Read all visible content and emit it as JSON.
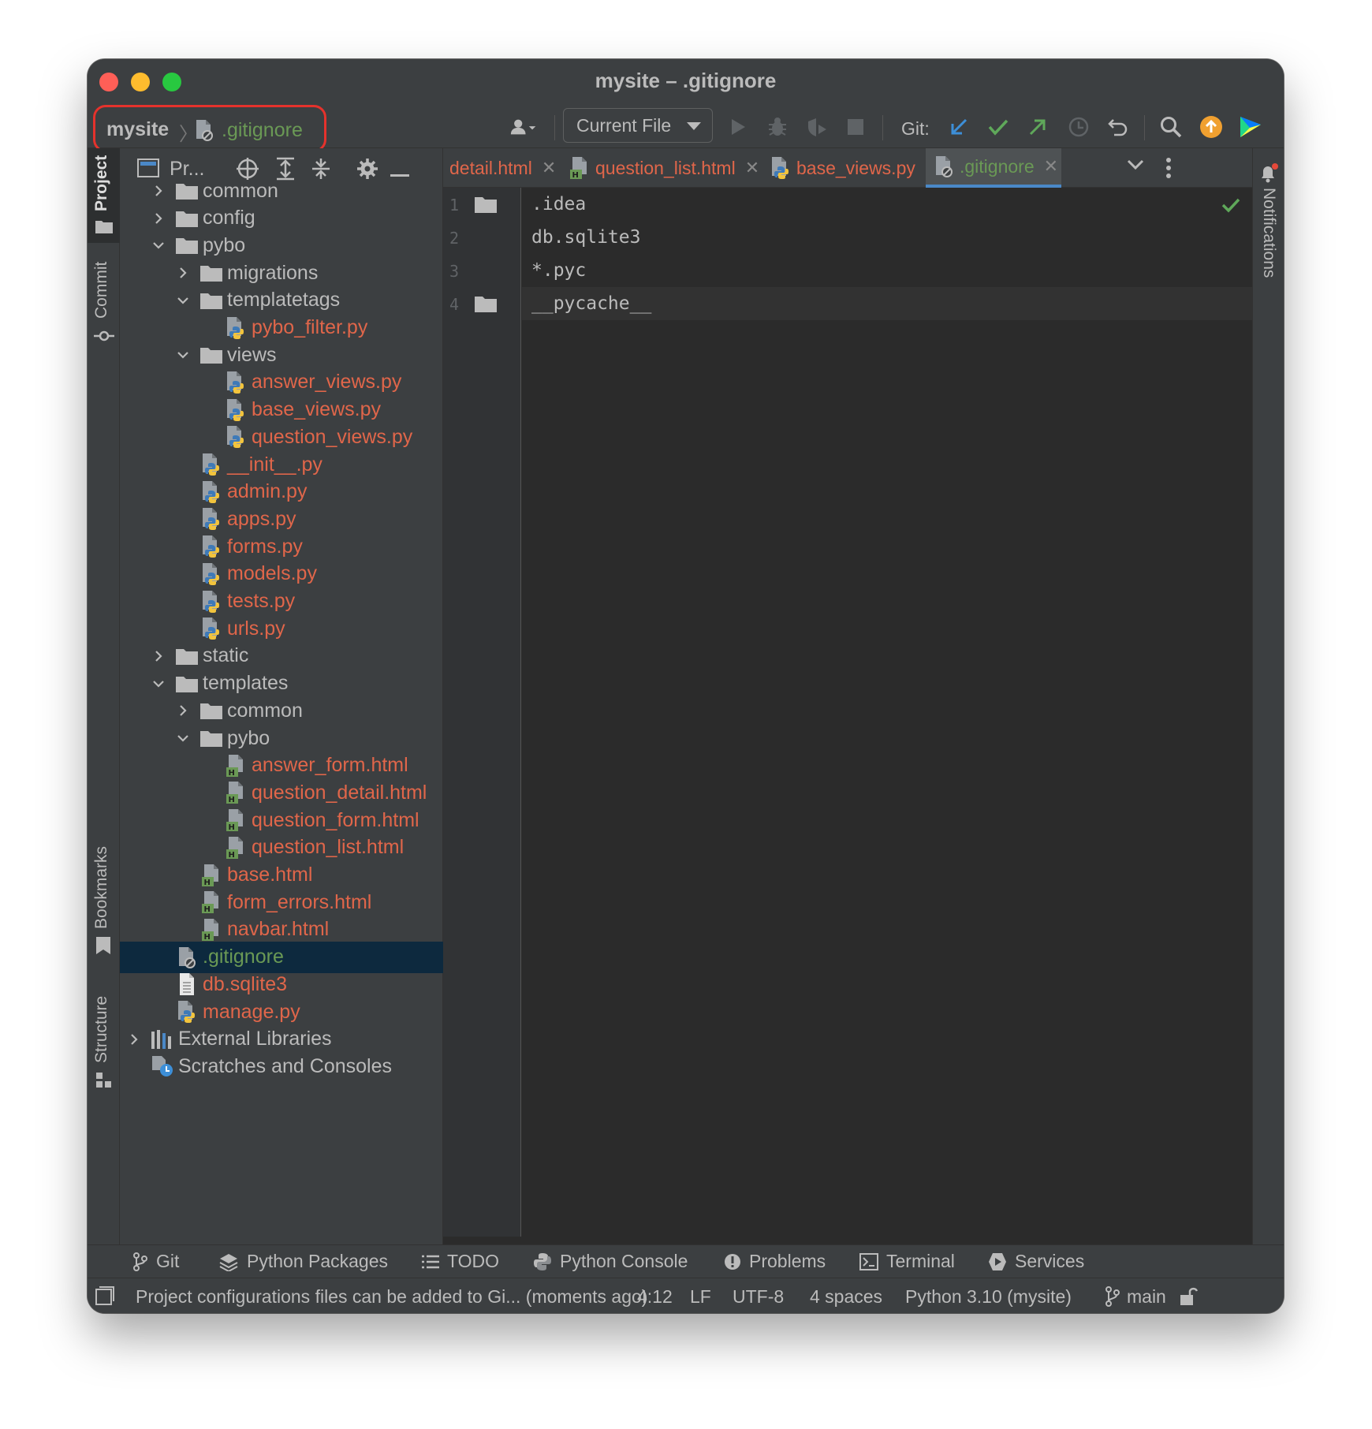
{
  "window": {
    "title": "mysite – .gitignore"
  },
  "breadcrumb": {
    "project": "mysite",
    "file": ".gitignore"
  },
  "toolbar": {
    "run_config": "Current File",
    "git_label": "Git:"
  },
  "left_stripe": {
    "project": "Project",
    "commit": "Commit",
    "bookmarks": "Bookmarks",
    "structure": "Structure"
  },
  "project_panel": {
    "title": "Pr...",
    "tree": [
      {
        "label": "common",
        "kind": "folder",
        "depth": 1,
        "expanded": false
      },
      {
        "label": "config",
        "kind": "folder",
        "depth": 1,
        "expanded": false
      },
      {
        "label": "pybo",
        "kind": "folder",
        "depth": 1,
        "expanded": true
      },
      {
        "label": "migrations",
        "kind": "folder",
        "depth": 2,
        "expanded": false
      },
      {
        "label": "templatetags",
        "kind": "folder",
        "depth": 2,
        "expanded": true
      },
      {
        "label": "pybo_filter.py",
        "kind": "py",
        "depth": 3
      },
      {
        "label": "views",
        "kind": "folder",
        "depth": 2,
        "expanded": true
      },
      {
        "label": "answer_views.py",
        "kind": "py",
        "depth": 3
      },
      {
        "label": "base_views.py",
        "kind": "py",
        "depth": 3
      },
      {
        "label": "question_views.py",
        "kind": "py",
        "depth": 3
      },
      {
        "label": "__init__.py",
        "kind": "py",
        "depth": 2
      },
      {
        "label": "admin.py",
        "kind": "py",
        "depth": 2
      },
      {
        "label": "apps.py",
        "kind": "py",
        "depth": 2
      },
      {
        "label": "forms.py",
        "kind": "py",
        "depth": 2
      },
      {
        "label": "models.py",
        "kind": "py",
        "depth": 2
      },
      {
        "label": "tests.py",
        "kind": "py",
        "depth": 2
      },
      {
        "label": "urls.py",
        "kind": "py",
        "depth": 2
      },
      {
        "label": "static",
        "kind": "folder",
        "depth": 1,
        "expanded": false
      },
      {
        "label": "templates",
        "kind": "folder",
        "depth": 1,
        "expanded": true
      },
      {
        "label": "common",
        "kind": "folder",
        "depth": 2,
        "expanded": false
      },
      {
        "label": "pybo",
        "kind": "folder",
        "depth": 2,
        "expanded": true
      },
      {
        "label": "answer_form.html",
        "kind": "html",
        "depth": 3
      },
      {
        "label": "question_detail.html",
        "kind": "html",
        "depth": 3
      },
      {
        "label": "question_form.html",
        "kind": "html",
        "depth": 3
      },
      {
        "label": "question_list.html",
        "kind": "html",
        "depth": 3
      },
      {
        "label": "base.html",
        "kind": "html",
        "depth": 2
      },
      {
        "label": "form_errors.html",
        "kind": "html",
        "depth": 2
      },
      {
        "label": "navbar.html",
        "kind": "html",
        "depth": 2
      },
      {
        "label": ".gitignore",
        "kind": "gitignore",
        "depth": 1,
        "selected": true
      },
      {
        "label": "db.sqlite3",
        "kind": "db",
        "depth": 1
      },
      {
        "label": "manage.py",
        "kind": "py",
        "depth": 1
      },
      {
        "label": "External Libraries",
        "kind": "lib",
        "depth": 0,
        "expanded": false
      },
      {
        "label": "Scratches and Consoles",
        "kind": "scratch",
        "depth": 0
      }
    ]
  },
  "tabs": [
    {
      "label": "detail.html",
      "kind": "html",
      "active": false
    },
    {
      "label": "question_list.html",
      "kind": "html",
      "active": false
    },
    {
      "label": "base_views.py",
      "kind": "py",
      "active": false
    },
    {
      "label": ".gitignore",
      "kind": "gitignore",
      "active": true
    }
  ],
  "editor": {
    "line_numbers": [
      "1",
      "2",
      "3",
      "4"
    ],
    "lines": [
      ".idea",
      "db.sqlite3",
      "*.pyc",
      "__pycache__"
    ],
    "current_line": 4
  },
  "right_stripe": {
    "notifications": "Notifications"
  },
  "bottom_tools": [
    {
      "label": "Git",
      "icon": "git-branch-icon"
    },
    {
      "label": "Python Packages",
      "icon": "layers-icon"
    },
    {
      "label": "TODO",
      "icon": "list-icon"
    },
    {
      "label": "Python Console",
      "icon": "python-icon"
    },
    {
      "label": "Problems",
      "icon": "problems-icon"
    },
    {
      "label": "Terminal",
      "icon": "terminal-icon"
    },
    {
      "label": "Services",
      "icon": "services-icon"
    }
  ],
  "status": {
    "message": "Project configurations files can be added to Gi... (moments ago)",
    "position": "4:12",
    "line_sep": "LF",
    "encoding": "UTF-8",
    "indent": "4 spaces",
    "interpreter": "Python 3.10 (mysite)",
    "branch": "main"
  },
  "colors": {
    "background": "#2b2b2b",
    "panel": "#3c3f41",
    "modified_file": "#e0664a",
    "added_file": "#6a9955",
    "selection": "#0d293e",
    "accent_blue": "#4a88c7",
    "highlight_box": "#e5322c"
  }
}
